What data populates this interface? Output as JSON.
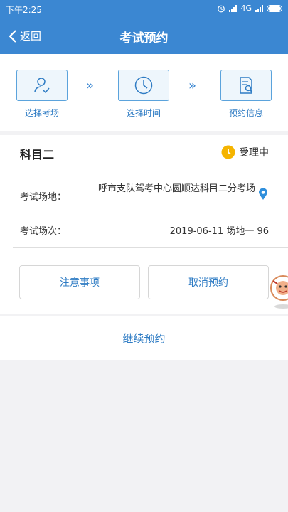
{
  "status_bar": {
    "time": "下午2:25",
    "network": "4G"
  },
  "nav": {
    "back_label": "返回",
    "title": "考试预约"
  },
  "steps": [
    {
      "label": "选择考场",
      "icon": "person-check-icon"
    },
    {
      "label": "选择时间",
      "icon": "clock-icon"
    },
    {
      "label": "预约信息",
      "icon": "document-search-icon"
    }
  ],
  "reservation": {
    "subject": "科目二",
    "status": "受理中",
    "venue_label": "考试场地：",
    "venue_value": "呼市支队驾考中心圆顺达科目二分考场",
    "session_label": "考试场次：",
    "session_value": "2019-06-11 场地一 96"
  },
  "actions": {
    "notice_label": "注意事项",
    "cancel_label": "取消预约"
  },
  "continue_label": "继续预约",
  "colors": {
    "primary": "#3b87d2",
    "link": "#2f7cc4",
    "status_dot": "#f5b400"
  }
}
